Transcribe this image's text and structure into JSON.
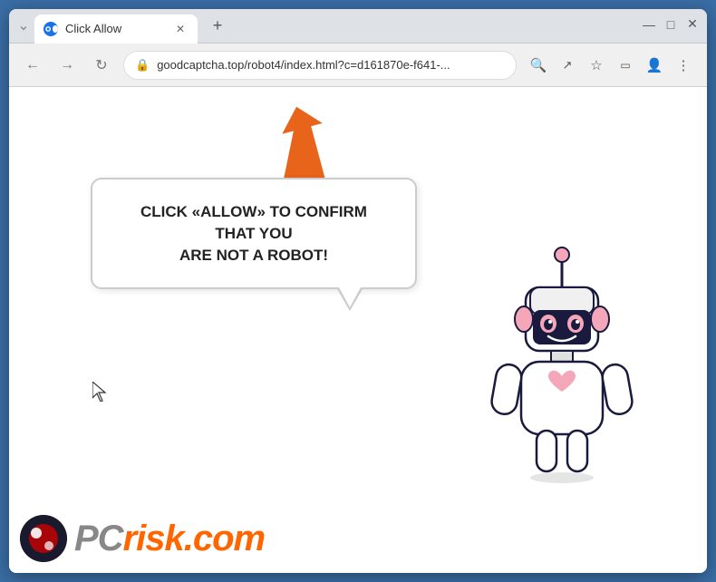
{
  "browser": {
    "tab": {
      "title": "Click Allow",
      "favicon_color": "#1a73e8"
    },
    "url": "goodcaptcha.top/robot4/index.html?c=d161870e-f641-...",
    "window_controls": {
      "minimize": "—",
      "maximize": "□",
      "close": "✕",
      "chevron_down": "⌄",
      "new_tab": "+"
    }
  },
  "page": {
    "bubble_text_line1": "CLICK «ALLOW» TO CONFIRM THAT YOU",
    "bubble_text_line2": "ARE NOT A ROBOT!",
    "arrow_color": "#e8641a"
  },
  "pcrisk": {
    "text": "PC",
    "suffix": "risk.com"
  },
  "nav": {
    "back": "←",
    "forward": "→",
    "refresh": "↻"
  },
  "toolbar": {
    "search_icon_label": "🔍",
    "share_icon_label": "↗",
    "bookmark_icon_label": "☆",
    "sidebar_icon_label": "▭",
    "profile_icon_label": "👤",
    "menu_icon_label": "⋮"
  }
}
